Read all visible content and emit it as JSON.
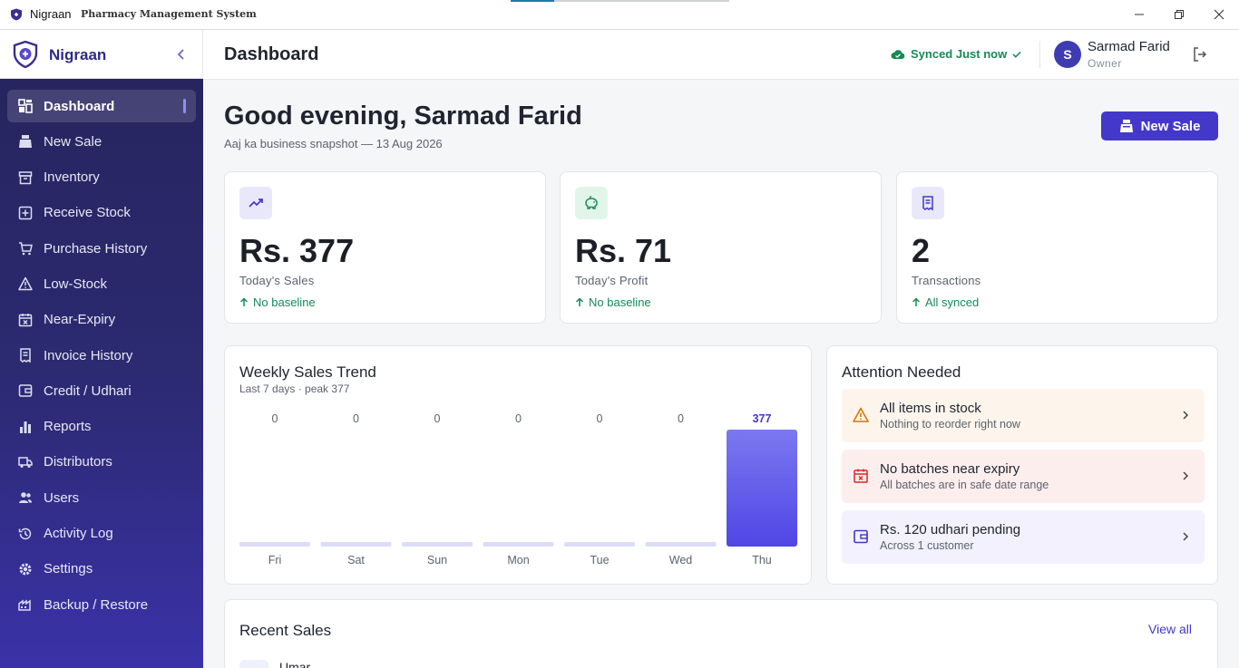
{
  "window": {
    "app_name": "Nigraan",
    "subtitle": "Pharmacy Management System"
  },
  "sidebar": {
    "brand": "Nigraan",
    "items": [
      {
        "label": "Dashboard",
        "icon": "dashboard-icon",
        "active": true
      },
      {
        "label": "New Sale",
        "icon": "register-icon"
      },
      {
        "label": "Inventory",
        "icon": "archive-icon"
      },
      {
        "label": "Receive Stock",
        "icon": "plus-box-icon"
      },
      {
        "label": "Purchase History",
        "icon": "cart-icon"
      },
      {
        "label": "Low-Stock",
        "icon": "warning-icon"
      },
      {
        "label": "Near-Expiry",
        "icon": "calendar-x-icon"
      },
      {
        "label": "Invoice History",
        "icon": "receipt-icon"
      },
      {
        "label": "Credit / Udhari",
        "icon": "wallet-icon"
      },
      {
        "label": "Reports",
        "icon": "bar-chart-icon"
      },
      {
        "label": "Distributors",
        "icon": "truck-icon"
      },
      {
        "label": "Users",
        "icon": "users-icon"
      },
      {
        "label": "Activity Log",
        "icon": "history-icon"
      },
      {
        "label": "Settings",
        "icon": "gear-icon"
      },
      {
        "label": "Backup / Restore",
        "icon": "backup-icon"
      }
    ]
  },
  "header": {
    "title": "Dashboard",
    "sync_status": "Synced Just now",
    "user_initial": "S",
    "user_name": "Sarmad Farid",
    "user_role": "Owner"
  },
  "main": {
    "greeting": "Good evening, Sarmad Farid",
    "snapshot": "Aaj ka business snapshot — 13 Aug 2026",
    "new_sale_label": "New Sale",
    "stats": [
      {
        "value": "Rs. 377",
        "label": "Today's Sales",
        "trend": "No baseline",
        "icon": "trending-up-icon"
      },
      {
        "value": "Rs. 71",
        "label": "Today's Profit",
        "trend": "No baseline",
        "icon": "piggy-bank-icon"
      },
      {
        "value": "2",
        "label": "Transactions",
        "trend": "All synced",
        "icon": "receipt-icon"
      }
    ],
    "weekly": {
      "title": "Weekly Sales Trend",
      "subtitle": "Last 7 days · peak 377"
    },
    "attention": {
      "title": "Attention Needed",
      "items": [
        {
          "title": "All items in stock",
          "subtitle": "Nothing to reorder right now",
          "icon": "warning-icon",
          "bg": "#fdf5ec",
          "color": "#d97706"
        },
        {
          "title": "No batches near expiry",
          "subtitle": "All batches are in safe date range",
          "icon": "calendar-x-icon",
          "bg": "#fdeeee",
          "color": "#dc2626"
        },
        {
          "title": "Rs. 120 udhari pending",
          "subtitle": "Across 1 customer",
          "icon": "wallet-icon",
          "bg": "#f2f1fd",
          "color": "#4338ca"
        }
      ]
    },
    "recent": {
      "title": "Recent Sales",
      "view_all": "View all",
      "first_row_name": "Umar"
    }
  },
  "colors": {
    "accent": "#4338ca",
    "success": "#168a54",
    "bar_gradient_top": "#7b78f0",
    "bar_gradient_bottom": "#4f46e5",
    "bar_empty": "#dddcf6"
  },
  "chart_data": {
    "type": "bar",
    "categories": [
      "Fri",
      "Sat",
      "Sun",
      "Mon",
      "Tue",
      "Wed",
      "Thu"
    ],
    "values": [
      0,
      0,
      0,
      0,
      0,
      0,
      377
    ],
    "data_labels": [
      "0",
      "0",
      "0",
      "0",
      "0",
      "0",
      "377"
    ],
    "ylim": [
      0,
      377
    ],
    "grid": false,
    "legend": "none"
  }
}
